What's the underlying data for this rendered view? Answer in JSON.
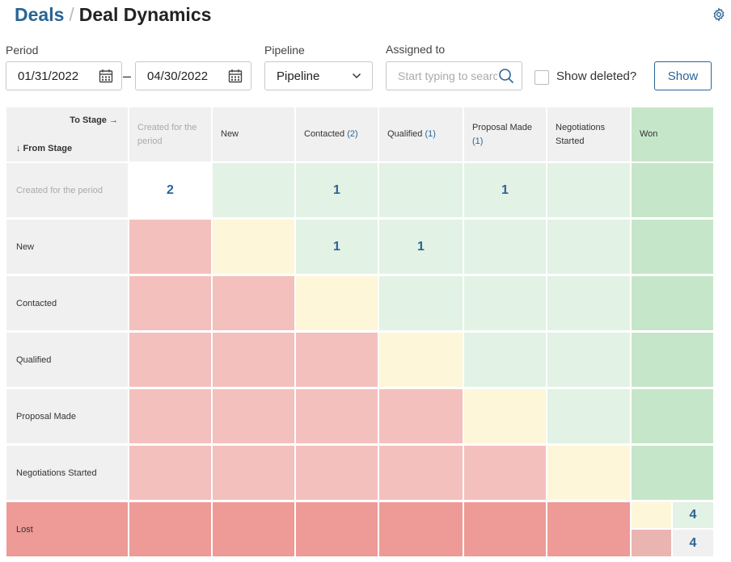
{
  "header": {
    "breadcrumb_link": "Deals",
    "separator": "/",
    "title": "Deal Dynamics"
  },
  "filters": {
    "period_label": "Period",
    "date_from": "01/31/2022",
    "date_separator": "–",
    "date_to": "04/30/2022",
    "pipeline_label": "Pipeline",
    "pipeline_value": "Pipeline",
    "assigned_label": "Assigned to",
    "assigned_placeholder": "Start typing to search",
    "show_deleted_label": "Show deleted?",
    "show_button": "Show"
  },
  "matrix": {
    "to_stage_label": "To Stage →",
    "from_stage_label": "↓ From Stage",
    "columns": [
      {
        "label": "Created for the period",
        "count": ""
      },
      {
        "label": "New",
        "count": ""
      },
      {
        "label": "Contacted",
        "count": "(2)"
      },
      {
        "label": "Qualified",
        "count": "(1)"
      },
      {
        "label": "Proposal Made",
        "count": "(1)"
      },
      {
        "label": "Negotiations Started",
        "count": ""
      },
      {
        "label": "Won",
        "count": ""
      }
    ],
    "rows": [
      {
        "label": "Created for the period",
        "cells": [
          "2",
          "",
          "1",
          "",
          "1",
          "",
          ""
        ]
      },
      {
        "label": "New",
        "cells": [
          "",
          "",
          "1",
          "1",
          "",
          "",
          ""
        ]
      },
      {
        "label": "Contacted",
        "cells": [
          "",
          "",
          "",
          "",
          "",
          "",
          ""
        ]
      },
      {
        "label": "Qualified",
        "cells": [
          "",
          "",
          "",
          "",
          "",
          "",
          ""
        ]
      },
      {
        "label": "Proposal Made",
        "cells": [
          "",
          "",
          "",
          "",
          "",
          "",
          ""
        ]
      },
      {
        "label": "Negotiations Started",
        "cells": [
          "",
          "",
          "",
          "",
          "",
          "",
          ""
        ]
      }
    ],
    "lost_row": {
      "label": "Lost",
      "won_total": "4",
      "lost_total": "4"
    }
  },
  "colors": {
    "brand": "#2a6496",
    "forward_stage": "#e2f2e5",
    "won_stage": "#c6e6c9",
    "same_stage": "#fdf6d8",
    "backward_stage": "#f3c0bd",
    "lost_stage": "#ee9a96"
  }
}
